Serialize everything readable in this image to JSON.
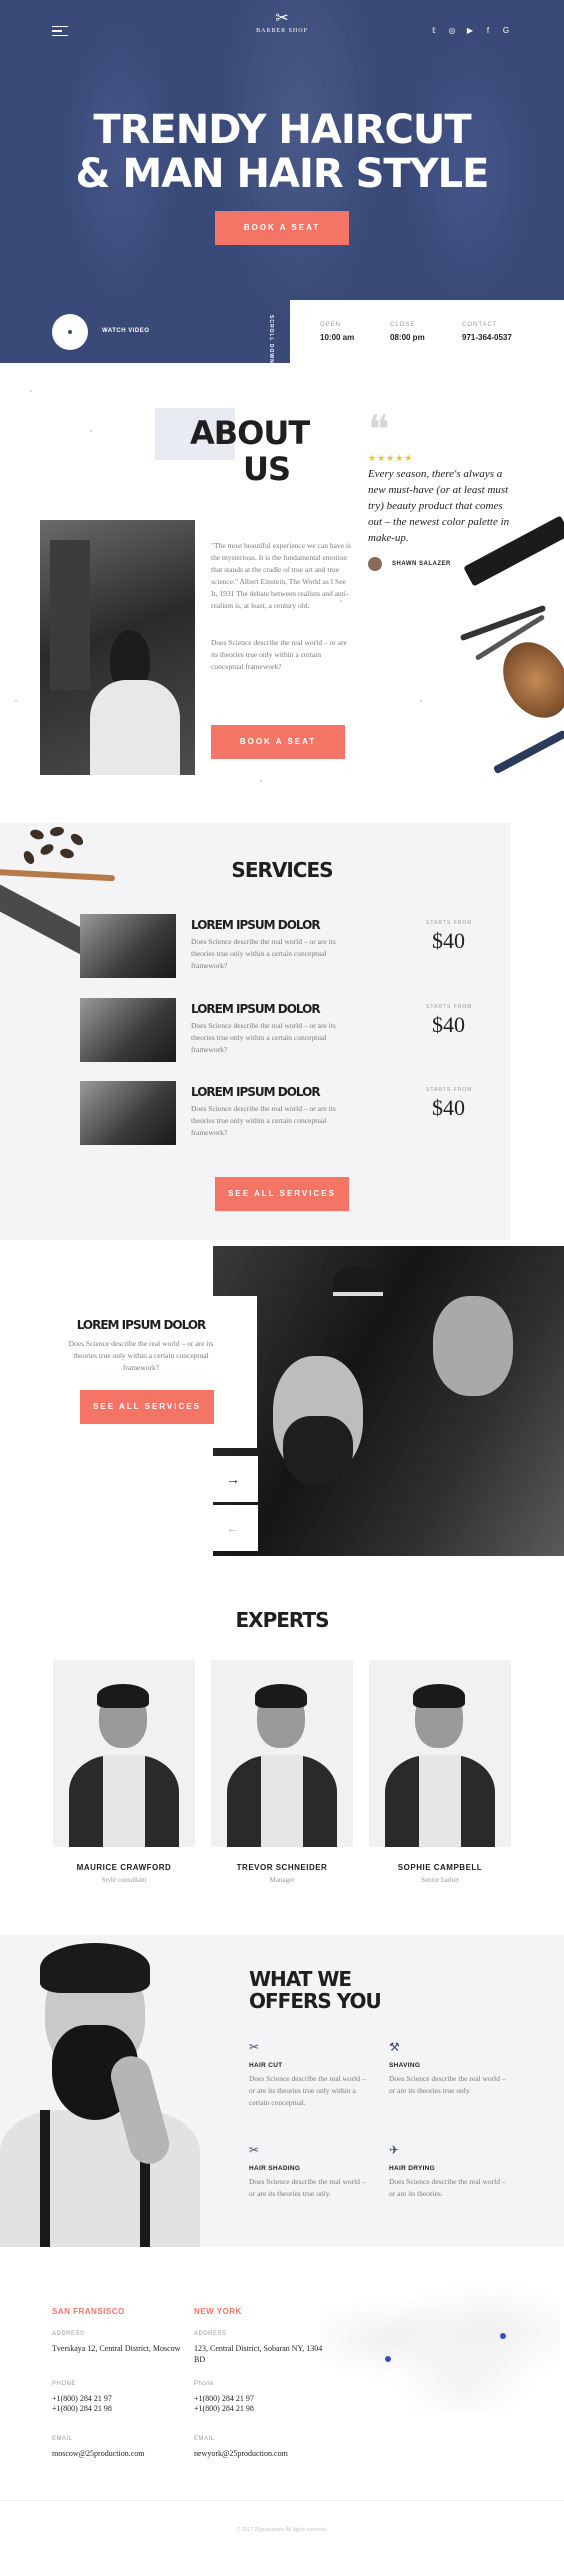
{
  "header": {
    "logo_mark": "✂",
    "logo_text": "BARBER SHOP",
    "socials": [
      "𝕥",
      "◎",
      "▶",
      "f",
      "G"
    ]
  },
  "hero": {
    "title_line1": "TRENDY HAIRCUT",
    "title_line2": "& MAN HAIR STYLE",
    "book_label": "BOOK A SEAT",
    "watch_label": "WATCH VIDEO",
    "scroll_label": "SCROLL DOWN"
  },
  "info": {
    "open_label": "OPEN",
    "open_value": "10:00 am",
    "close_label": "CLOSE",
    "close_value": "08:00 pm",
    "contact_label": "CONTACT",
    "contact_value": "971-364-0537"
  },
  "about": {
    "title_line1": "ABOUT",
    "title_line2": "US",
    "para1": "\"The most beautiful experience we can have is the mysterious. It is the fundamental emotion that stands at the cradle of true art and true science.\" Albert Einstein, The World as I See It, 1931 The debate between realism and anti-realism is, at least, a century old.",
    "para2": "Does Science describe the real world – or are its theories true only within a certain conceptual framework?",
    "book_label": "BOOK A SEAT",
    "quote_mark": "❝",
    "stars": "★★★★★",
    "quote": "Every season, there's always a new must-have (or at least must try) beauty product that comes out – the newest color palette in make-up.",
    "author": "SHAWN SALAZER"
  },
  "services": {
    "title": "SERVICES",
    "items": [
      {
        "name": "LOREM IPSUM DOLOR",
        "desc": "Does Science describe the real world – or are its theories true only within a certain conceptual framework?",
        "price_label": "STARTS FROM",
        "price": "$40"
      },
      {
        "name": "LOREM IPSUM DOLOR",
        "desc": "Does Science describe the real world – or are its theories true only within a certain conceptual framework?",
        "price_label": "STARTS FROM",
        "price": "$40"
      },
      {
        "name": "LOREM IPSUM DOLOR",
        "desc": "Does Science describe the real world – or are its theories true only within a certain conceptual framework?",
        "price_label": "STARTS FROM",
        "price": "$40"
      }
    ],
    "see_all_label": "SEE ALL SERVICES"
  },
  "feature": {
    "title": "LOREM IPSUM DOLOR",
    "desc": "Does Science describe the real world – or are its theories true only within a certain conceptual framework?",
    "button_label": "SEE ALL SERVICES",
    "next_arrow": "→",
    "prev_arrow": "←"
  },
  "experts": {
    "title": "EXPERTS",
    "items": [
      {
        "name": "MAURICE CRAWFORD",
        "role": "Style consultant"
      },
      {
        "name": "TREVOR SCHNEIDER",
        "role": "Manager"
      },
      {
        "name": "SOPHIE CAMPBELL",
        "role": "Senior barber"
      }
    ]
  },
  "offers": {
    "title_line1": "WHAT WE",
    "title_line2": "OFFERS YOU",
    "items": [
      {
        "icon": "✂",
        "name": "HAIR CUT",
        "desc": "Does Science describe the real world – or are its theories true only within a certain conceptual."
      },
      {
        "icon": "⚒",
        "name": "SHAVING",
        "desc": "Does Science describe the real world – or are its theories true only."
      },
      {
        "icon": "✂",
        "name": "HAIR SHADING",
        "desc": "Does Science describe the real world – or are its theories true only."
      },
      {
        "icon": "✈",
        "name": "HAIR DRYING",
        "desc": "Does Science describe the real world – or are its theories."
      }
    ]
  },
  "contacts": {
    "sf": {
      "city": "SAN FRANSISCO",
      "address_label": "ADDRESS",
      "address": "Tverskaya 12, Central District, Moscow",
      "phone_label": "PHONE",
      "phone1": "+1(800) 284 21 97",
      "phone2": "+1(800) 284 21 98",
      "email_label": "EMAIL",
      "email": "moscow@25production.com"
    },
    "ny": {
      "city": "NEW YORK",
      "address_label": "ADDRESS",
      "address": "123, Central District, Sobaran NY, 1304 BD",
      "phone_label": "Phone",
      "phone1": "+1(800) 284 21 97",
      "phone2": "+1(800) 284 21 98",
      "email_label": "EMAIL",
      "email": "newyork@25production.com"
    },
    "copyright": "© 2017 25production. All rights reserved."
  },
  "colors": {
    "brand_navy": "#3a4a78",
    "accent_coral": "#f47566",
    "star_yellow": "#f2c21b"
  }
}
